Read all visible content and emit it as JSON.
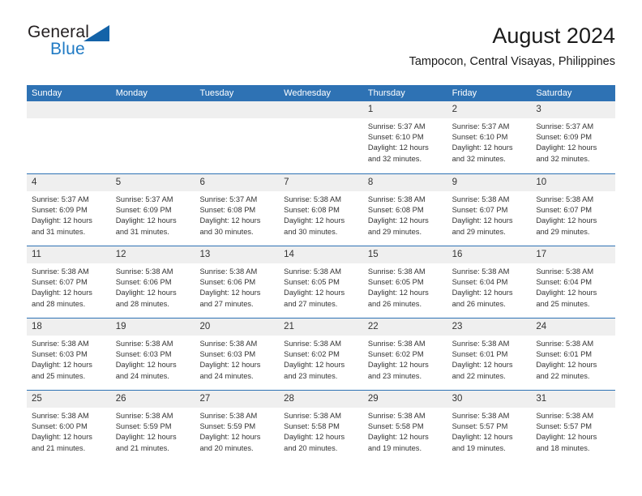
{
  "brand": {
    "name_top": "General",
    "name_bottom": "Blue",
    "triangle_color": "#1463a8",
    "blue_text_color": "#1f7ac4"
  },
  "header": {
    "title": "August 2024",
    "subtitle": "Tampocon, Central Visayas, Philippines"
  },
  "theme": {
    "header_blue": "#2e72b4",
    "day_band_gray": "#efefef",
    "text": "#333333"
  },
  "weekdays": [
    "Sunday",
    "Monday",
    "Tuesday",
    "Wednesday",
    "Thursday",
    "Friday",
    "Saturday"
  ],
  "labels": {
    "sunrise_prefix": "Sunrise:",
    "sunset_prefix": "Sunset:",
    "daylight_prefix": "Daylight:"
  },
  "weeks": [
    [
      {
        "day": "",
        "sunrise": "",
        "sunset": "",
        "daylight_line1": "",
        "daylight_line2": ""
      },
      {
        "day": "",
        "sunrise": "",
        "sunset": "",
        "daylight_line1": "",
        "daylight_line2": ""
      },
      {
        "day": "",
        "sunrise": "",
        "sunset": "",
        "daylight_line1": "",
        "daylight_line2": ""
      },
      {
        "day": "",
        "sunrise": "",
        "sunset": "",
        "daylight_line1": "",
        "daylight_line2": ""
      },
      {
        "day": "1",
        "sunrise": "Sunrise: 5:37 AM",
        "sunset": "Sunset: 6:10 PM",
        "daylight_line1": "Daylight: 12 hours",
        "daylight_line2": "and 32 minutes."
      },
      {
        "day": "2",
        "sunrise": "Sunrise: 5:37 AM",
        "sunset": "Sunset: 6:10 PM",
        "daylight_line1": "Daylight: 12 hours",
        "daylight_line2": "and 32 minutes."
      },
      {
        "day": "3",
        "sunrise": "Sunrise: 5:37 AM",
        "sunset": "Sunset: 6:09 PM",
        "daylight_line1": "Daylight: 12 hours",
        "daylight_line2": "and 32 minutes."
      }
    ],
    [
      {
        "day": "4",
        "sunrise": "Sunrise: 5:37 AM",
        "sunset": "Sunset: 6:09 PM",
        "daylight_line1": "Daylight: 12 hours",
        "daylight_line2": "and 31 minutes."
      },
      {
        "day": "5",
        "sunrise": "Sunrise: 5:37 AM",
        "sunset": "Sunset: 6:09 PM",
        "daylight_line1": "Daylight: 12 hours",
        "daylight_line2": "and 31 minutes."
      },
      {
        "day": "6",
        "sunrise": "Sunrise: 5:37 AM",
        "sunset": "Sunset: 6:08 PM",
        "daylight_line1": "Daylight: 12 hours",
        "daylight_line2": "and 30 minutes."
      },
      {
        "day": "7",
        "sunrise": "Sunrise: 5:38 AM",
        "sunset": "Sunset: 6:08 PM",
        "daylight_line1": "Daylight: 12 hours",
        "daylight_line2": "and 30 minutes."
      },
      {
        "day": "8",
        "sunrise": "Sunrise: 5:38 AM",
        "sunset": "Sunset: 6:08 PM",
        "daylight_line1": "Daylight: 12 hours",
        "daylight_line2": "and 29 minutes."
      },
      {
        "day": "9",
        "sunrise": "Sunrise: 5:38 AM",
        "sunset": "Sunset: 6:07 PM",
        "daylight_line1": "Daylight: 12 hours",
        "daylight_line2": "and 29 minutes."
      },
      {
        "day": "10",
        "sunrise": "Sunrise: 5:38 AM",
        "sunset": "Sunset: 6:07 PM",
        "daylight_line1": "Daylight: 12 hours",
        "daylight_line2": "and 29 minutes."
      }
    ],
    [
      {
        "day": "11",
        "sunrise": "Sunrise: 5:38 AM",
        "sunset": "Sunset: 6:07 PM",
        "daylight_line1": "Daylight: 12 hours",
        "daylight_line2": "and 28 minutes."
      },
      {
        "day": "12",
        "sunrise": "Sunrise: 5:38 AM",
        "sunset": "Sunset: 6:06 PM",
        "daylight_line1": "Daylight: 12 hours",
        "daylight_line2": "and 28 minutes."
      },
      {
        "day": "13",
        "sunrise": "Sunrise: 5:38 AM",
        "sunset": "Sunset: 6:06 PM",
        "daylight_line1": "Daylight: 12 hours",
        "daylight_line2": "and 27 minutes."
      },
      {
        "day": "14",
        "sunrise": "Sunrise: 5:38 AM",
        "sunset": "Sunset: 6:05 PM",
        "daylight_line1": "Daylight: 12 hours",
        "daylight_line2": "and 27 minutes."
      },
      {
        "day": "15",
        "sunrise": "Sunrise: 5:38 AM",
        "sunset": "Sunset: 6:05 PM",
        "daylight_line1": "Daylight: 12 hours",
        "daylight_line2": "and 26 minutes."
      },
      {
        "day": "16",
        "sunrise": "Sunrise: 5:38 AM",
        "sunset": "Sunset: 6:04 PM",
        "daylight_line1": "Daylight: 12 hours",
        "daylight_line2": "and 26 minutes."
      },
      {
        "day": "17",
        "sunrise": "Sunrise: 5:38 AM",
        "sunset": "Sunset: 6:04 PM",
        "daylight_line1": "Daylight: 12 hours",
        "daylight_line2": "and 25 minutes."
      }
    ],
    [
      {
        "day": "18",
        "sunrise": "Sunrise: 5:38 AM",
        "sunset": "Sunset: 6:03 PM",
        "daylight_line1": "Daylight: 12 hours",
        "daylight_line2": "and 25 minutes."
      },
      {
        "day": "19",
        "sunrise": "Sunrise: 5:38 AM",
        "sunset": "Sunset: 6:03 PM",
        "daylight_line1": "Daylight: 12 hours",
        "daylight_line2": "and 24 minutes."
      },
      {
        "day": "20",
        "sunrise": "Sunrise: 5:38 AM",
        "sunset": "Sunset: 6:03 PM",
        "daylight_line1": "Daylight: 12 hours",
        "daylight_line2": "and 24 minutes."
      },
      {
        "day": "21",
        "sunrise": "Sunrise: 5:38 AM",
        "sunset": "Sunset: 6:02 PM",
        "daylight_line1": "Daylight: 12 hours",
        "daylight_line2": "and 23 minutes."
      },
      {
        "day": "22",
        "sunrise": "Sunrise: 5:38 AM",
        "sunset": "Sunset: 6:02 PM",
        "daylight_line1": "Daylight: 12 hours",
        "daylight_line2": "and 23 minutes."
      },
      {
        "day": "23",
        "sunrise": "Sunrise: 5:38 AM",
        "sunset": "Sunset: 6:01 PM",
        "daylight_line1": "Daylight: 12 hours",
        "daylight_line2": "and 22 minutes."
      },
      {
        "day": "24",
        "sunrise": "Sunrise: 5:38 AM",
        "sunset": "Sunset: 6:01 PM",
        "daylight_line1": "Daylight: 12 hours",
        "daylight_line2": "and 22 minutes."
      }
    ],
    [
      {
        "day": "25",
        "sunrise": "Sunrise: 5:38 AM",
        "sunset": "Sunset: 6:00 PM",
        "daylight_line1": "Daylight: 12 hours",
        "daylight_line2": "and 21 minutes."
      },
      {
        "day": "26",
        "sunrise": "Sunrise: 5:38 AM",
        "sunset": "Sunset: 5:59 PM",
        "daylight_line1": "Daylight: 12 hours",
        "daylight_line2": "and 21 minutes."
      },
      {
        "day": "27",
        "sunrise": "Sunrise: 5:38 AM",
        "sunset": "Sunset: 5:59 PM",
        "daylight_line1": "Daylight: 12 hours",
        "daylight_line2": "and 20 minutes."
      },
      {
        "day": "28",
        "sunrise": "Sunrise: 5:38 AM",
        "sunset": "Sunset: 5:58 PM",
        "daylight_line1": "Daylight: 12 hours",
        "daylight_line2": "and 20 minutes."
      },
      {
        "day": "29",
        "sunrise": "Sunrise: 5:38 AM",
        "sunset": "Sunset: 5:58 PM",
        "daylight_line1": "Daylight: 12 hours",
        "daylight_line2": "and 19 minutes."
      },
      {
        "day": "30",
        "sunrise": "Sunrise: 5:38 AM",
        "sunset": "Sunset: 5:57 PM",
        "daylight_line1": "Daylight: 12 hours",
        "daylight_line2": "and 19 minutes."
      },
      {
        "day": "31",
        "sunrise": "Sunrise: 5:38 AM",
        "sunset": "Sunset: 5:57 PM",
        "daylight_line1": "Daylight: 12 hours",
        "daylight_line2": "and 18 minutes."
      }
    ]
  ]
}
